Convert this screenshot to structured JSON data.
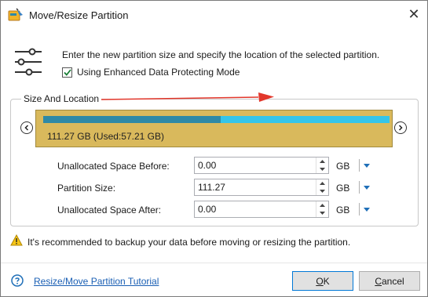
{
  "window": {
    "title": "Move/Resize Partition",
    "close_glyph": "✕"
  },
  "intro": {
    "text": "Enter the new partition size and specify the location of the selected partition.",
    "checkbox_label": "Using Enhanced Data Protecting Mode",
    "checkbox_checked": true
  },
  "group": {
    "title": "Size And Location",
    "partition_label": "111.27 GB (Used:57.21 GB)",
    "used_fraction": 0.51
  },
  "fields": [
    {
      "label": "Unallocated Space Before:",
      "value": "0.00",
      "unit": "GB"
    },
    {
      "label": "Partition Size:",
      "value": "111.27",
      "unit": "GB"
    },
    {
      "label": "Unallocated Space After:",
      "value": "0.00",
      "unit": "GB"
    }
  ],
  "warning": {
    "text": "It's recommended to backup your data before moving or resizing the partition."
  },
  "footer": {
    "tutorial_link": "Resize/Move Partition Tutorial",
    "ok_label_u": "O",
    "ok_label_rest": "K",
    "cancel_label_u": "C",
    "cancel_label_rest": "ancel"
  },
  "colors": {
    "partition_bg": "#d9b95c",
    "used_bar": "#2e89a6",
    "free_bar": "#34c5ea",
    "arrow": "#e2372b",
    "link": "#1a5fb4",
    "accent": "#0078d7"
  },
  "icons": [
    "app-icon",
    "close-icon",
    "sliders-icon",
    "checkmark-icon",
    "chevron-left-icon",
    "chevron-right-icon",
    "spin-up-icon",
    "spin-down-icon",
    "dropdown-icon",
    "warning-icon",
    "help-icon"
  ]
}
